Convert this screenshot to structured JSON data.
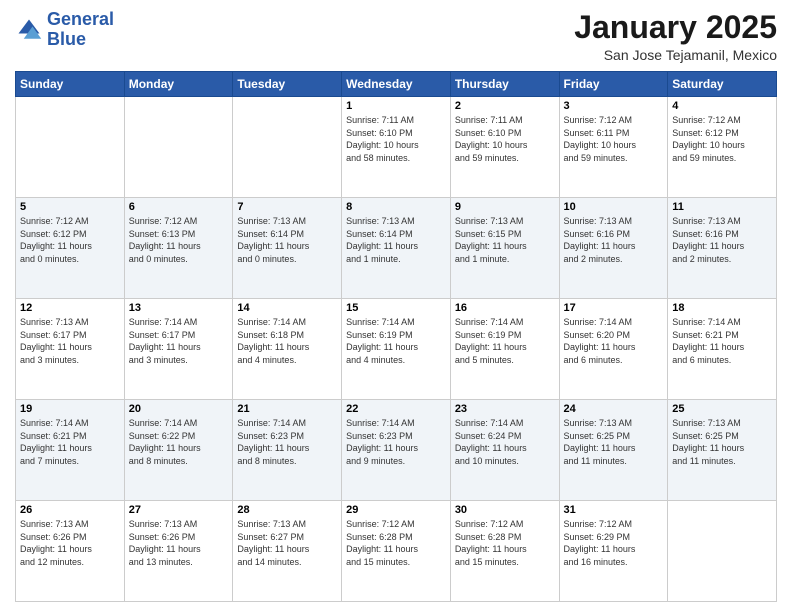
{
  "header": {
    "logo_line1": "General",
    "logo_line2": "Blue",
    "title": "January 2025",
    "subtitle": "San Jose Tejamanil, Mexico"
  },
  "days_of_week": [
    "Sunday",
    "Monday",
    "Tuesday",
    "Wednesday",
    "Thursday",
    "Friday",
    "Saturday"
  ],
  "weeks": [
    [
      {
        "day": "",
        "info": ""
      },
      {
        "day": "",
        "info": ""
      },
      {
        "day": "",
        "info": ""
      },
      {
        "day": "1",
        "info": "Sunrise: 7:11 AM\nSunset: 6:10 PM\nDaylight: 10 hours\nand 58 minutes."
      },
      {
        "day": "2",
        "info": "Sunrise: 7:11 AM\nSunset: 6:10 PM\nDaylight: 10 hours\nand 59 minutes."
      },
      {
        "day": "3",
        "info": "Sunrise: 7:12 AM\nSunset: 6:11 PM\nDaylight: 10 hours\nand 59 minutes."
      },
      {
        "day": "4",
        "info": "Sunrise: 7:12 AM\nSunset: 6:12 PM\nDaylight: 10 hours\nand 59 minutes."
      }
    ],
    [
      {
        "day": "5",
        "info": "Sunrise: 7:12 AM\nSunset: 6:12 PM\nDaylight: 11 hours\nand 0 minutes."
      },
      {
        "day": "6",
        "info": "Sunrise: 7:12 AM\nSunset: 6:13 PM\nDaylight: 11 hours\nand 0 minutes."
      },
      {
        "day": "7",
        "info": "Sunrise: 7:13 AM\nSunset: 6:14 PM\nDaylight: 11 hours\nand 0 minutes."
      },
      {
        "day": "8",
        "info": "Sunrise: 7:13 AM\nSunset: 6:14 PM\nDaylight: 11 hours\nand 1 minute."
      },
      {
        "day": "9",
        "info": "Sunrise: 7:13 AM\nSunset: 6:15 PM\nDaylight: 11 hours\nand 1 minute."
      },
      {
        "day": "10",
        "info": "Sunrise: 7:13 AM\nSunset: 6:16 PM\nDaylight: 11 hours\nand 2 minutes."
      },
      {
        "day": "11",
        "info": "Sunrise: 7:13 AM\nSunset: 6:16 PM\nDaylight: 11 hours\nand 2 minutes."
      }
    ],
    [
      {
        "day": "12",
        "info": "Sunrise: 7:13 AM\nSunset: 6:17 PM\nDaylight: 11 hours\nand 3 minutes."
      },
      {
        "day": "13",
        "info": "Sunrise: 7:14 AM\nSunset: 6:17 PM\nDaylight: 11 hours\nand 3 minutes."
      },
      {
        "day": "14",
        "info": "Sunrise: 7:14 AM\nSunset: 6:18 PM\nDaylight: 11 hours\nand 4 minutes."
      },
      {
        "day": "15",
        "info": "Sunrise: 7:14 AM\nSunset: 6:19 PM\nDaylight: 11 hours\nand 4 minutes."
      },
      {
        "day": "16",
        "info": "Sunrise: 7:14 AM\nSunset: 6:19 PM\nDaylight: 11 hours\nand 5 minutes."
      },
      {
        "day": "17",
        "info": "Sunrise: 7:14 AM\nSunset: 6:20 PM\nDaylight: 11 hours\nand 6 minutes."
      },
      {
        "day": "18",
        "info": "Sunrise: 7:14 AM\nSunset: 6:21 PM\nDaylight: 11 hours\nand 6 minutes."
      }
    ],
    [
      {
        "day": "19",
        "info": "Sunrise: 7:14 AM\nSunset: 6:21 PM\nDaylight: 11 hours\nand 7 minutes."
      },
      {
        "day": "20",
        "info": "Sunrise: 7:14 AM\nSunset: 6:22 PM\nDaylight: 11 hours\nand 8 minutes."
      },
      {
        "day": "21",
        "info": "Sunrise: 7:14 AM\nSunset: 6:23 PM\nDaylight: 11 hours\nand 8 minutes."
      },
      {
        "day": "22",
        "info": "Sunrise: 7:14 AM\nSunset: 6:23 PM\nDaylight: 11 hours\nand 9 minutes."
      },
      {
        "day": "23",
        "info": "Sunrise: 7:14 AM\nSunset: 6:24 PM\nDaylight: 11 hours\nand 10 minutes."
      },
      {
        "day": "24",
        "info": "Sunrise: 7:13 AM\nSunset: 6:25 PM\nDaylight: 11 hours\nand 11 minutes."
      },
      {
        "day": "25",
        "info": "Sunrise: 7:13 AM\nSunset: 6:25 PM\nDaylight: 11 hours\nand 11 minutes."
      }
    ],
    [
      {
        "day": "26",
        "info": "Sunrise: 7:13 AM\nSunset: 6:26 PM\nDaylight: 11 hours\nand 12 minutes."
      },
      {
        "day": "27",
        "info": "Sunrise: 7:13 AM\nSunset: 6:26 PM\nDaylight: 11 hours\nand 13 minutes."
      },
      {
        "day": "28",
        "info": "Sunrise: 7:13 AM\nSunset: 6:27 PM\nDaylight: 11 hours\nand 14 minutes."
      },
      {
        "day": "29",
        "info": "Sunrise: 7:12 AM\nSunset: 6:28 PM\nDaylight: 11 hours\nand 15 minutes."
      },
      {
        "day": "30",
        "info": "Sunrise: 7:12 AM\nSunset: 6:28 PM\nDaylight: 11 hours\nand 15 minutes."
      },
      {
        "day": "31",
        "info": "Sunrise: 7:12 AM\nSunset: 6:29 PM\nDaylight: 11 hours\nand 16 minutes."
      },
      {
        "day": "",
        "info": ""
      }
    ]
  ]
}
